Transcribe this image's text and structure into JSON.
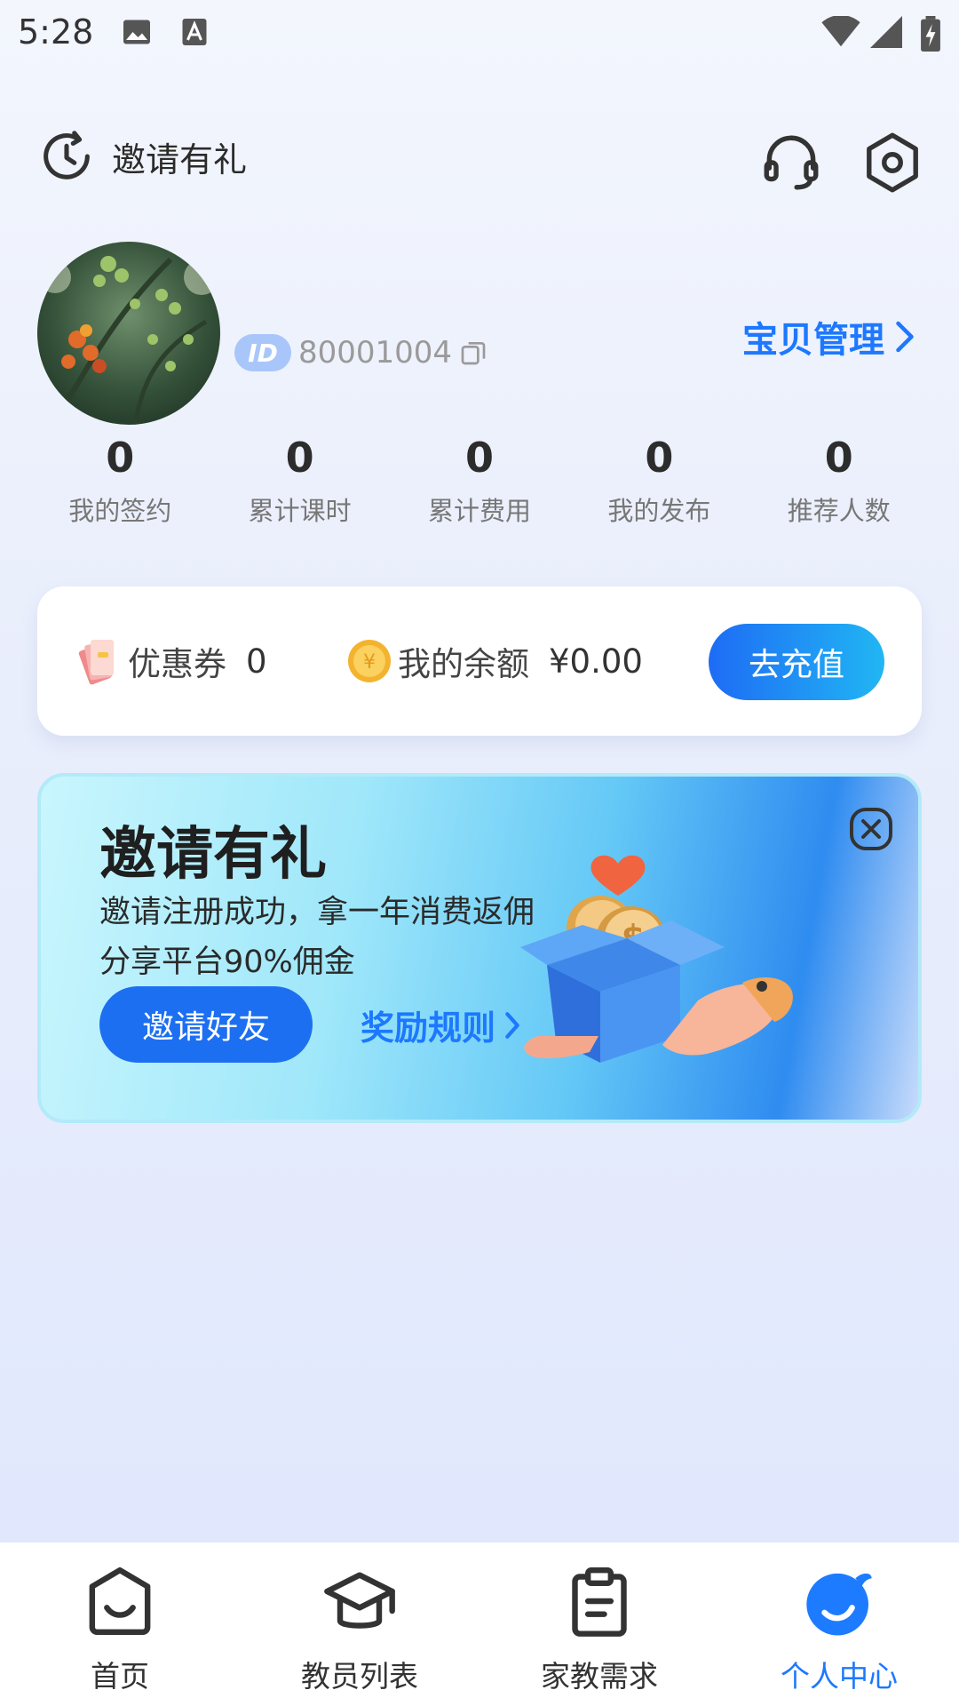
{
  "status_bar": {
    "time": "5:28"
  },
  "header": {
    "invite_label": "邀请有礼"
  },
  "profile": {
    "id_badge": "ID",
    "id_number": "80001004",
    "manage_label": "宝贝管理"
  },
  "stats": [
    {
      "value": "0",
      "label": "我的签约"
    },
    {
      "value": "0",
      "label": "累计课时"
    },
    {
      "value": "0",
      "label": "累计费用"
    },
    {
      "value": "0",
      "label": "我的发布"
    },
    {
      "value": "0",
      "label": "推荐人数"
    }
  ],
  "wallet": {
    "coupon_label": "优惠券",
    "coupon_value": "0",
    "balance_label": "我的余额",
    "balance_value": "¥0.00",
    "recharge_label": "去充值"
  },
  "banner": {
    "title": "邀请有礼",
    "line1": "邀请注册成功，拿一年消费返佣",
    "line2": "分享平台90%佣金",
    "invite_button": "邀请好友",
    "rules_link": "奖励规则"
  },
  "nav": [
    {
      "label": "首页",
      "icon": "home-icon"
    },
    {
      "label": "教员列表",
      "icon": "graduation-cap-icon"
    },
    {
      "label": "家教需求",
      "icon": "clipboard-icon"
    },
    {
      "label": "个人中心",
      "icon": "profile-icon",
      "active": true
    }
  ],
  "colors": {
    "accent": "#1d78ff",
    "banner_blue": "#2f8cf0"
  }
}
